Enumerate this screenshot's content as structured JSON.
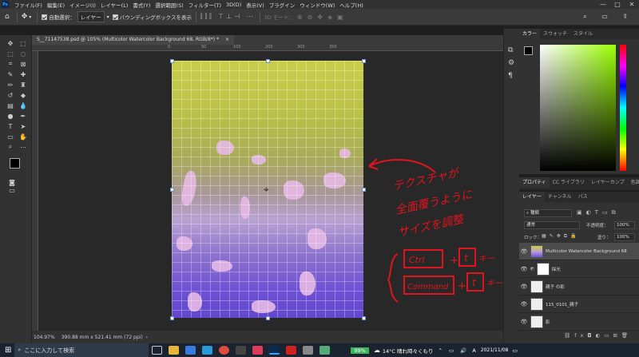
{
  "app": {
    "logo": "Ps"
  },
  "menu": [
    "ファイル(F)",
    "編集(E)",
    "イメージ(I)",
    "レイヤー(L)",
    "書式(Y)",
    "選択範囲(S)",
    "フィルター(T)",
    "3D(D)",
    "表示(V)",
    "プラグイン",
    "ウィンドウ(W)",
    "ヘルプ(H)"
  ],
  "window_controls": [
    "—",
    "□",
    "✕"
  ],
  "options": {
    "auto_select_label": "自動選択：",
    "auto_select_target": "レイヤー",
    "transform_controls_label": "バウンディングボックスを表示",
    "mode_3d": "3D モード："
  },
  "document": {
    "tab_title": "S__71147538.psd @ 105% (Multicolor Watercolor Background 68, RGB/8*) *",
    "tab_close": "×",
    "ruler_h": [
      "0",
      "50",
      "100",
      "150",
      "200",
      "250",
      "300",
      "350",
      "400"
    ],
    "ruler_v": [
      "5",
      "1",
      "5",
      "0",
      "5",
      "0",
      "5",
      "0",
      "5",
      "0",
      "5",
      "0"
    ]
  },
  "status": {
    "zoom": "104.97%",
    "dimensions": "390.88 mm x 521.41 mm (72 ppi)"
  },
  "color_panel": {
    "tabs": [
      "カラー",
      "スウォッチ",
      "スタイル"
    ],
    "foreground": "#000000",
    "background": "#ffffff",
    "hue_color": "#9aff00"
  },
  "properties_panel": {
    "tabs": [
      "プロパティ",
      "CC ライブラリ",
      "レイヤーカンプ",
      "色調補正"
    ]
  },
  "layers_panel": {
    "tabs": [
      "レイヤー",
      "チャンネル",
      "パス"
    ],
    "filter_label": "種類",
    "blend_mode": "通常",
    "opacity_label": "不透明度：",
    "opacity_value": "100%",
    "lock_label": "ロック：",
    "fill_label": "塗り：",
    "fill_value": "100%",
    "layers": [
      {
        "name": "Multicolor Watercolor Background 68",
        "selected": true
      },
      {
        "name": "採光",
        "selected": false
      },
      {
        "name": "親子 の影",
        "selected": false
      },
      {
        "name": "115_0101_親子",
        "selected": false
      },
      {
        "name": "影",
        "selected": false
      }
    ],
    "footer_icons": [
      "link-icon",
      "fx-icon",
      "mask-icon",
      "adjustment-icon",
      "folder-icon",
      "new-layer-icon",
      "trash-icon"
    ]
  },
  "annotation": {
    "line1": "テクスチャが",
    "line2": "全面覆うように",
    "line3": "サイズを調整",
    "shortcut1_key1": "Ctrl",
    "shortcut1_key2": "t",
    "shortcut1_suffix": "キー",
    "shortcut2_key1": "Command",
    "shortcut2_key2": "t",
    "shortcut2_suffix": "キー",
    "plus": "+",
    "color": "#e0141e"
  },
  "taskbar": {
    "search_placeholder": "ここに入力して検索",
    "battery": "99%",
    "weather": "14°C  晴れ時々くもり",
    "input_mode": "A",
    "time": "",
    "date": "2021/11/08"
  }
}
